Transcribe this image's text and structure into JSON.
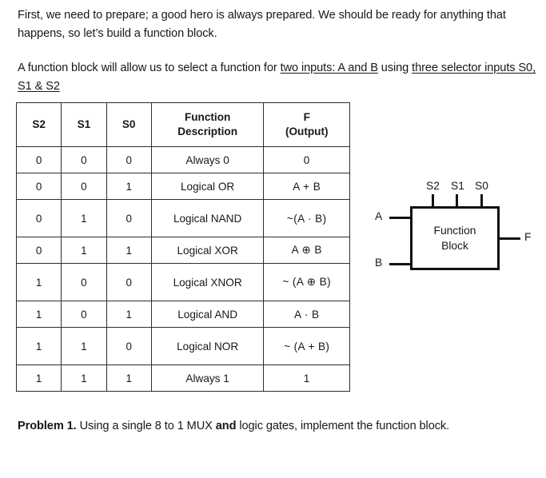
{
  "intro": {
    "paragraph": "First, we need to prepare; a good hero is always prepared. We should be ready for anything that happens, so let’s  build a function block."
  },
  "spec": {
    "lead": "A function block will allow us to select a function for ",
    "underlined_inputs": "two inputs: A and B",
    "middle": " using ",
    "underlined_selectors": "three selector inputs S0, S1 & S2"
  },
  "table": {
    "headers": [
      "S2",
      "S1",
      "S0",
      "Function Description",
      "F (Output)"
    ],
    "header_lines": {
      "function_description": [
        "Function",
        "Description"
      ],
      "f_output": [
        "F",
        "(Output)"
      ]
    },
    "rows": [
      {
        "s2": "0",
        "s1": "0",
        "s0": "0",
        "description": "Always 0",
        "f": "0",
        "tall": false
      },
      {
        "s2": "0",
        "s1": "0",
        "s0": "1",
        "description": "Logical OR",
        "f": "A + B",
        "tall": false
      },
      {
        "s2": "0",
        "s1": "1",
        "s0": "0",
        "description": "Logical NAND",
        "f": "~(A · B)",
        "tall": true
      },
      {
        "s2": "0",
        "s1": "1",
        "s0": "1",
        "description": "Logical XOR",
        "f": "A ⊕ B",
        "tall": false
      },
      {
        "s2": "1",
        "s1": "0",
        "s0": "0",
        "description": "Logical XNOR",
        "f": "~ (A ⊕ B)",
        "tall": true
      },
      {
        "s2": "1",
        "s1": "0",
        "s0": "1",
        "description": "Logical AND",
        "f": "A ·  B",
        "tall": false
      },
      {
        "s2": "1",
        "s1": "1",
        "s0": "0",
        "description": "Logical NOR",
        "f": "~ (A + B)",
        "tall": true
      },
      {
        "s2": "1",
        "s1": "1",
        "s0": "1",
        "description": "Always 1",
        "f": "1",
        "tall": false
      }
    ]
  },
  "diagram": {
    "block_label_line1": "Function",
    "block_label_line2": "Block",
    "input_a": "A",
    "input_b": "B",
    "output_f": "F",
    "selector_s2": "S2",
    "selector_s1": "S1",
    "selector_s0": "S0"
  },
  "problem": {
    "label": "Problem 1.",
    "text_before_bold": " Using a single 8 to 1 MUX ",
    "bold_word": "and",
    "text_after_bold": " logic gates, implement the function block."
  },
  "colors": {
    "text": "#181818",
    "table_border": "#2d2d2d",
    "diagram_stroke": "#111111",
    "background": "#ffffff"
  }
}
